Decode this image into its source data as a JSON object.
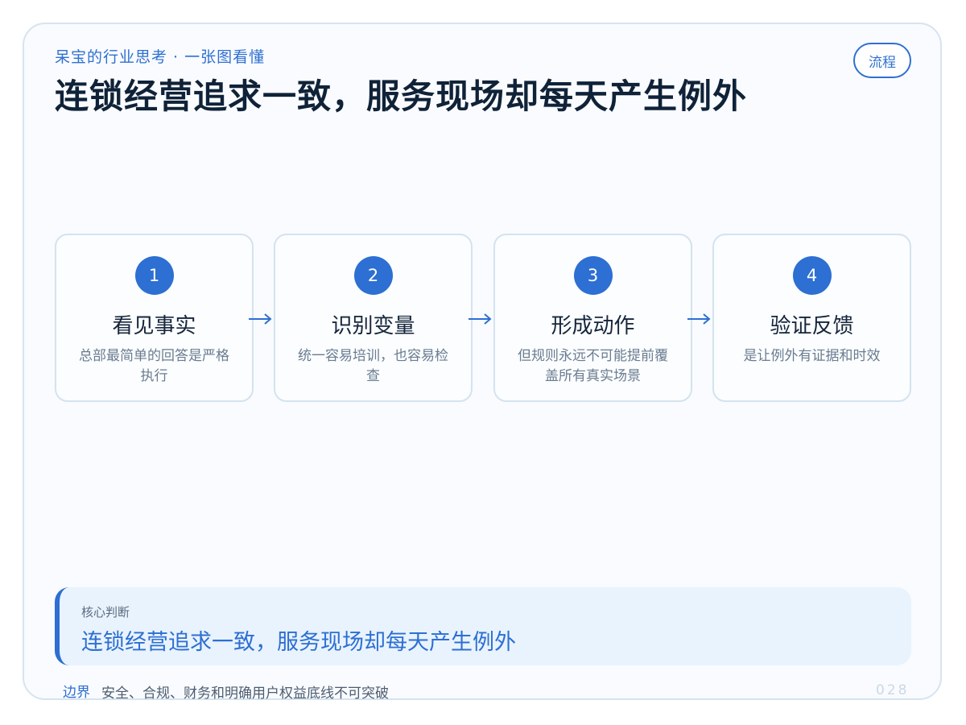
{
  "header": {
    "series": "呆宝的行业思考 · 一张图看懂",
    "title": "连锁经营追求一致，服务现场却每天产生例外",
    "tag": "流程"
  },
  "steps": [
    {
      "num": "1",
      "title": "看见事实",
      "desc": "总部最简单的回答是严格执行"
    },
    {
      "num": "2",
      "title": "识别变量",
      "desc": "统一容易培训，也容易检查"
    },
    {
      "num": "3",
      "title": "形成动作",
      "desc": "但规则永远不可能提前覆盖所有真实场景"
    },
    {
      "num": "4",
      "title": "验证反馈",
      "desc": "是让例外有证据和时效"
    }
  ],
  "judgement": {
    "label": "核心判断",
    "text": "连锁经营追求一致，服务现场却每天产生例外"
  },
  "footer": {
    "label": "边界",
    "text": "安全、合规、财务和明确用户权益底线不可突破",
    "page": "028"
  },
  "colors": {
    "accent": "#2d6fd2",
    "title": "#0f2238",
    "muted": "#6a7c90",
    "border": "#d4e3ef"
  }
}
